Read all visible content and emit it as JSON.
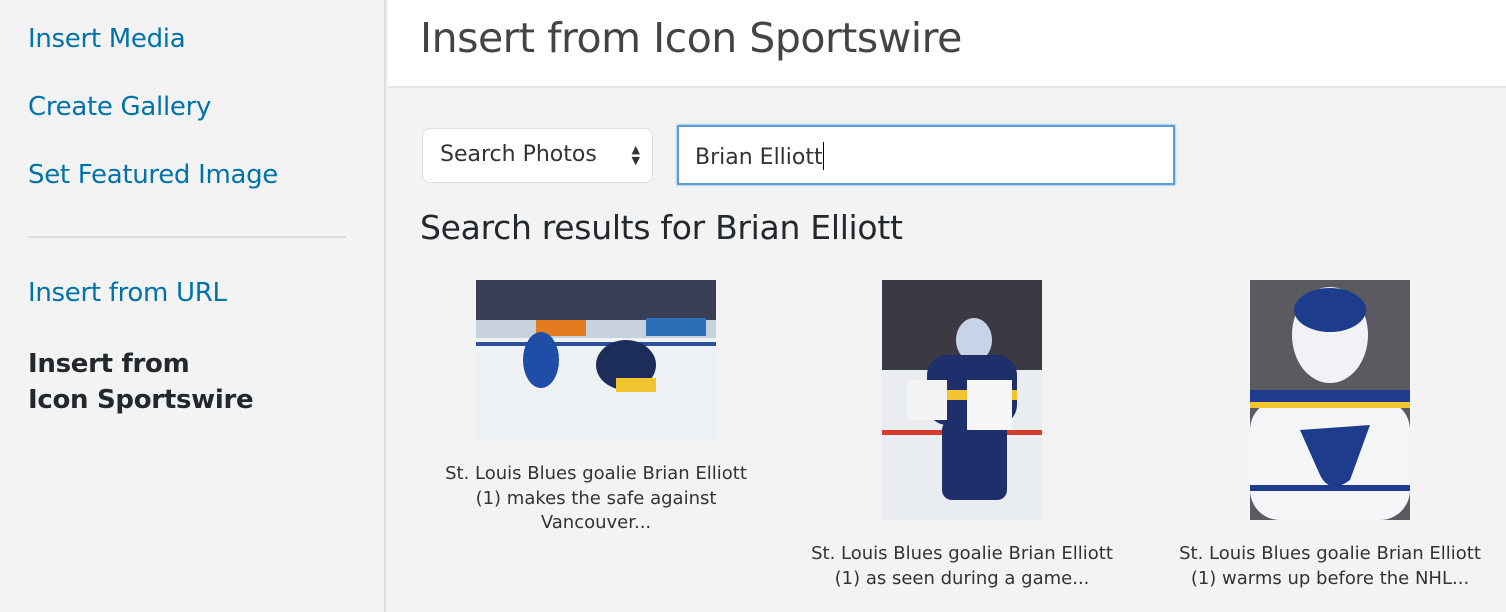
{
  "sidebar": {
    "items": [
      {
        "label": "Insert Media"
      },
      {
        "label": "Create Gallery"
      },
      {
        "label": "Set Featured Image"
      },
      {
        "label": "Insert from URL"
      },
      {
        "label": "Insert from Icon Sportswire",
        "line1": "Insert from",
        "line2": "Icon Sportswire",
        "active": true
      }
    ]
  },
  "header": {
    "title": "Insert from Icon Sportswire"
  },
  "search": {
    "type_selected": "Search Photos",
    "query": "Brian Elliott"
  },
  "results": {
    "heading": "Search results for Brian Elliott",
    "items": [
      {
        "caption_line1": "St. Louis Blues goalie Brian Elliott",
        "caption_line2": "(1) makes the safe against",
        "caption_line3": "Vancouver..."
      },
      {
        "caption_line1": "St. Louis Blues goalie Brian Elliott",
        "caption_line2": "(1) as seen during a game..."
      },
      {
        "caption_line1": "St. Louis Blues goalie Brian Elliott",
        "caption_line2": "(1) warms up before the NHL..."
      }
    ]
  },
  "colors": {
    "link": "#0073aa",
    "focus": "#5b9dd9"
  }
}
